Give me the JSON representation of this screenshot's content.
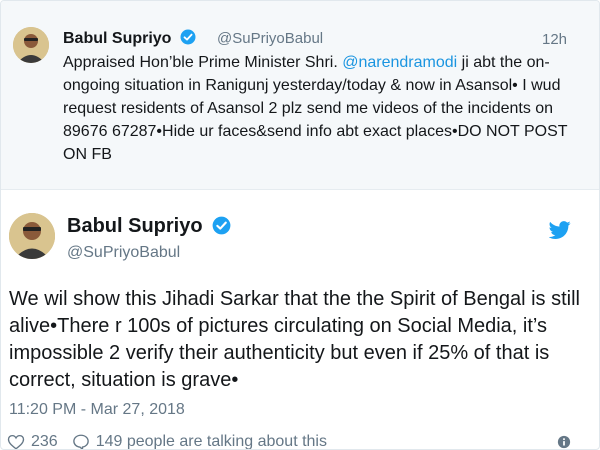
{
  "parent_tweet": {
    "name": "Babul Supriyo",
    "handle": "@SuPriyoBabul",
    "time": "12h",
    "text_before_mention": "Appraised Hon’ble Prime Minister Shri. ",
    "mention": "@narendramodi",
    "text_after_mention": " ji abt the on-ongoing situation in Ranigunj yesterday/today & now in Asansol• I wud request residents of Asansol 2 plz send me videos of the incidents on 89676 67287•Hide ur faces&send info abt exact places•DO NOT POST ON FB"
  },
  "main_tweet": {
    "name": "Babul Supriyo",
    "handle": "@SuPriyoBabul",
    "text": "We wil show this Jihadi Sarkar that the the Spirit of Bengal is still alive•There r 100s of pictures circulating on Social Media, it’s impossible 2 verify their authenticity but even if 25% of that is correct, situation is grave•",
    "timestamp": "11:20 PM - Mar 27, 2018",
    "like_count": "236",
    "talking_label": "149 people are talking about this"
  },
  "icons": {
    "verified": "verified-badge-icon",
    "twitter": "twitter-bird-icon",
    "like": "heart-icon",
    "reply": "speech-bubble-icon",
    "info": "info-icon"
  },
  "colors": {
    "twitter_blue": "#1da1f2",
    "link_blue": "#1b95e0",
    "muted_text": "#657786",
    "parent_background": "#f5f8fa"
  }
}
